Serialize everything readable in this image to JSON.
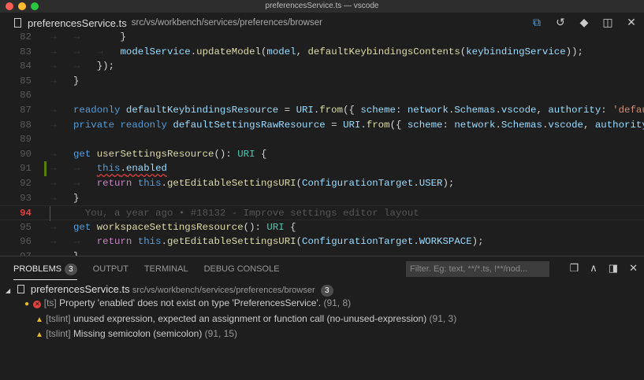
{
  "window": {
    "title": "preferencesService.ts — vscode"
  },
  "tab": {
    "file_icon": "file-icon",
    "filename": "preferencesService.ts",
    "path": "src/vs/workbench/services/preferences/browser"
  },
  "editor": {
    "lines": [
      {
        "n": "82",
        "tokens": [
          [
            "        }",
            "pl"
          ]
        ]
      },
      {
        "n": "83",
        "tokens": [
          [
            "        ",
            "pl"
          ],
          [
            "modelService",
            "var"
          ],
          [
            ".",
            "pl"
          ],
          [
            "updateModel",
            "fn"
          ],
          [
            "(",
            "pl"
          ],
          [
            "model",
            "var"
          ],
          [
            ", ",
            "pl"
          ],
          [
            "defaultKeybindingsContents",
            "fn"
          ],
          [
            "(",
            "pl"
          ],
          [
            "keybindingService",
            "var"
          ],
          [
            "));",
            "pl"
          ]
        ]
      },
      {
        "n": "84",
        "tokens": [
          [
            "    });",
            "pl"
          ]
        ]
      },
      {
        "n": "85",
        "tokens": [
          [
            "}",
            "pl"
          ]
        ]
      },
      {
        "n": "86",
        "tokens": []
      },
      {
        "n": "87",
        "tokens": [
          [
            "readonly ",
            "kw"
          ],
          [
            "defaultKeybindingsResource",
            "var"
          ],
          [
            " = ",
            "pl"
          ],
          [
            "URI",
            "var"
          ],
          [
            ".",
            "pl"
          ],
          [
            "from",
            "fn"
          ],
          [
            "({ ",
            "pl"
          ],
          [
            "scheme",
            "var"
          ],
          [
            ": ",
            "pl"
          ],
          [
            "network",
            "var"
          ],
          [
            ".",
            "pl"
          ],
          [
            "Schemas",
            "var"
          ],
          [
            ".",
            "pl"
          ],
          [
            "vscode",
            "var"
          ],
          [
            ", ",
            "pl"
          ],
          [
            "authority",
            "var"
          ],
          [
            ": ",
            "pl"
          ],
          [
            "'defaultsettings'",
            "str"
          ]
        ]
      },
      {
        "n": "88",
        "tokens": [
          [
            "private ",
            "kw"
          ],
          [
            "readonly ",
            "kw"
          ],
          [
            "defaultSettingsRawResource",
            "var"
          ],
          [
            " = ",
            "pl"
          ],
          [
            "URI",
            "var"
          ],
          [
            ".",
            "pl"
          ],
          [
            "from",
            "fn"
          ],
          [
            "({ ",
            "pl"
          ],
          [
            "scheme",
            "var"
          ],
          [
            ": ",
            "pl"
          ],
          [
            "network",
            "var"
          ],
          [
            ".",
            "pl"
          ],
          [
            "Schemas",
            "var"
          ],
          [
            ".",
            "pl"
          ],
          [
            "vscode",
            "var"
          ],
          [
            ", ",
            "pl"
          ],
          [
            "authority",
            "var"
          ]
        ]
      },
      {
        "n": "89",
        "tokens": []
      },
      {
        "n": "90",
        "tokens": [
          [
            "get ",
            "kw"
          ],
          [
            "userSettingsResource",
            "fn"
          ],
          [
            "(): ",
            "pl"
          ],
          [
            "URI",
            "ty"
          ],
          [
            " {",
            "pl"
          ]
        ]
      },
      {
        "n": "91",
        "tokens": [
          [
            "    ",
            "pl"
          ],
          [
            "this",
            "kw"
          ],
          [
            ".",
            "pl"
          ],
          [
            "enabled",
            "var"
          ]
        ]
      },
      {
        "n": "92",
        "tokens": [
          [
            "    ",
            "pl"
          ],
          [
            "return ",
            "ctl"
          ],
          [
            "this",
            "kw"
          ],
          [
            ".",
            "pl"
          ],
          [
            "getEditableSettingsURI",
            "fn"
          ],
          [
            "(",
            "pl"
          ],
          [
            "ConfigurationTarget",
            "var"
          ],
          [
            ".",
            "pl"
          ],
          [
            "USER",
            "var"
          ],
          [
            ");",
            "pl"
          ]
        ]
      },
      {
        "n": "93",
        "tokens": [
          [
            "}",
            "pl"
          ]
        ]
      },
      {
        "n": "94",
        "tokens": [
          [
            "  You, a year ago • #18132 - Improve settings editor layout",
            "blame"
          ]
        ]
      },
      {
        "n": "95",
        "tokens": [
          [
            "get ",
            "kw"
          ],
          [
            "workspaceSettingsResource",
            "fn"
          ],
          [
            "(): ",
            "pl"
          ],
          [
            "URI",
            "ty"
          ],
          [
            " {",
            "pl"
          ]
        ]
      },
      {
        "n": "96",
        "tokens": [
          [
            "    ",
            "pl"
          ],
          [
            "return ",
            "ctl"
          ],
          [
            "this",
            "kw"
          ],
          [
            ".",
            "pl"
          ],
          [
            "getEditableSettingsURI",
            "fn"
          ],
          [
            "(",
            "pl"
          ],
          [
            "ConfigurationTarget",
            "var"
          ],
          [
            ".",
            "pl"
          ],
          [
            "WORKSPACE",
            "var"
          ],
          [
            ");",
            "pl"
          ]
        ]
      },
      {
        "n": "97",
        "tokens": [
          [
            "}",
            "pl"
          ]
        ]
      }
    ]
  },
  "panel": {
    "tabs": [
      {
        "label": "PROBLEMS",
        "count": "3"
      },
      {
        "label": "OUTPUT"
      },
      {
        "label": "TERMINAL"
      },
      {
        "label": "DEBUG CONSOLE"
      }
    ],
    "filter_placeholder": "Filter. Eg: text, **/*.ts, !**/nod...",
    "file": {
      "name": "preferencesService.ts",
      "path": "src/vs/workbench/services/preferences/browser",
      "count": "3"
    },
    "problems": [
      {
        "severity": "error",
        "source": "[ts]",
        "message": "Property 'enabled' does not exist on type 'PreferencesService'.",
        "loc": "(91, 8)"
      },
      {
        "severity": "warning",
        "source": "[tslint]",
        "message": "unused expression, expected an assignment or function call (no-unused-expression)",
        "loc": "(91, 3)"
      },
      {
        "severity": "warning",
        "source": "[tslint]",
        "message": "Missing semicolon (semicolon)",
        "loc": "(91, 15)"
      }
    ]
  },
  "colors": {
    "error": "#e04040",
    "warning": "#e8b931",
    "git_modified": "#587c0c"
  }
}
